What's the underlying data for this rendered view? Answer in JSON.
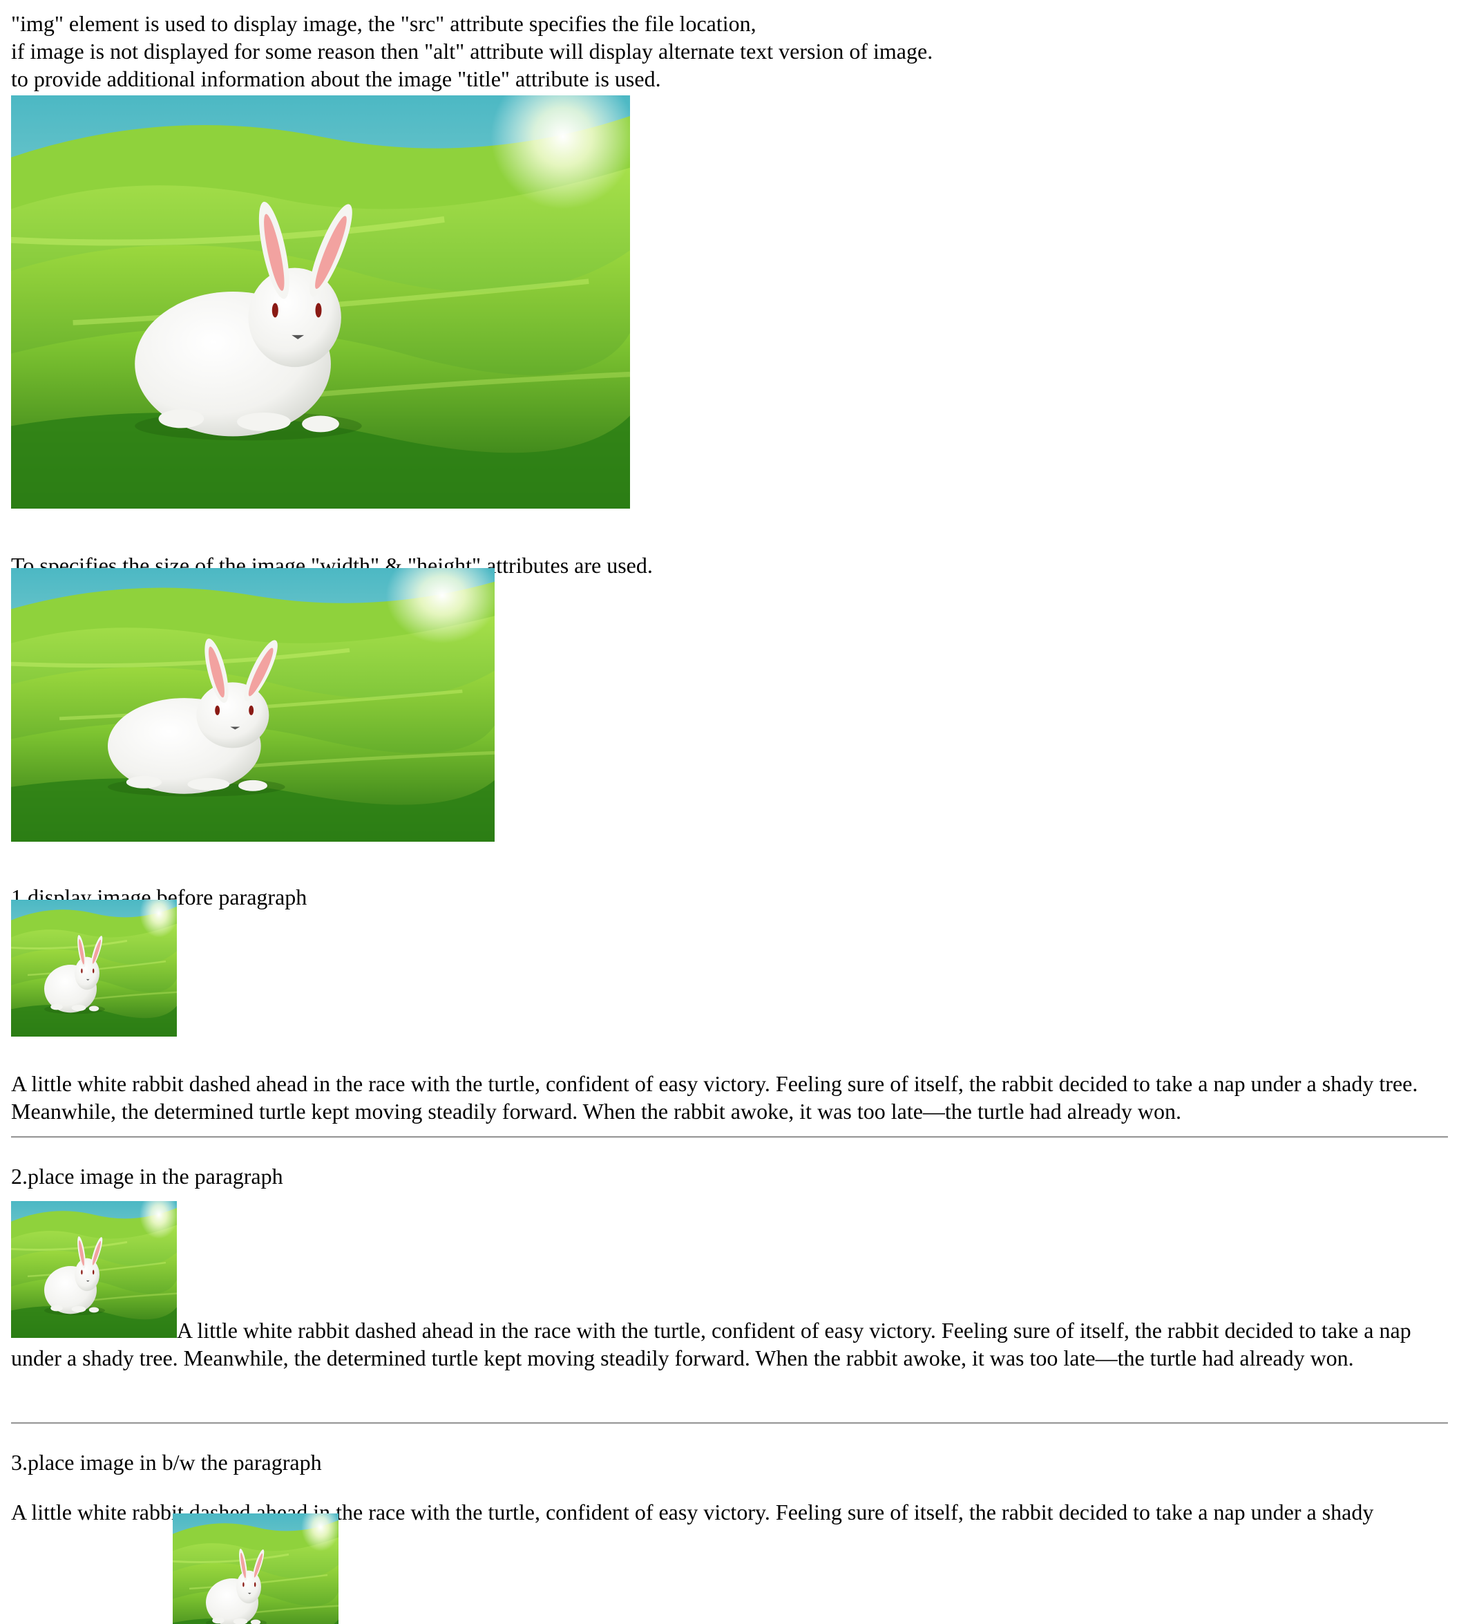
{
  "intro": {
    "line1": "\"img\" element is used to display image, the \"src\" attribute specifies the file location,",
    "line2": "if image is not displayed for some reason then \"alt\" attribute will display alternate text version of image.",
    "line3": "to provide additional information about the image \"title\" attribute is used."
  },
  "size_note": "To specifies the size of the image \"width\" & \"height\" attributes are used.",
  "sections": [
    {
      "heading": "1.display image before paragraph"
    },
    {
      "heading": "2.place image in the paragraph"
    },
    {
      "heading": "3.place image in b/w the paragraph"
    }
  ],
  "story": "A little white rabbit dashed ahead in the race with the turtle, confident of easy victory. Feeling sure of itself, the rabbit decided to take a nap under a shady tree. Meanwhile, the determined turtle kept moving steadily forward. When the rabbit awoke, it was too late—the turtle had already won.",
  "story_fragment": "A little white rabbit dashed ahead in the race with the turtle, confident of easy victory. Feeling sure of itself, the rabbit decided to take a nap under a shady",
  "colors": {
    "grass_light": "#8ed33a",
    "grass_dark": "#2f8a1a",
    "sky": "#bfe6f2",
    "rabbit": "#f7f7f5",
    "ear_inner": "#f2a2a0",
    "rule": "#9a9a9a"
  }
}
